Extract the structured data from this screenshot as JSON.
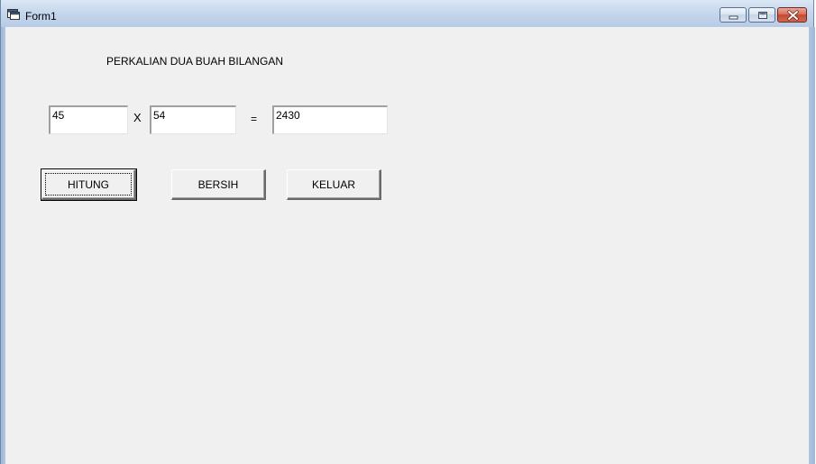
{
  "window": {
    "title": "Form1"
  },
  "form": {
    "heading": "PERKALIAN DUA BUAH BILANGAN",
    "operand1": "45",
    "operator": "X",
    "operand2": "54",
    "equals": "=",
    "result": "2430"
  },
  "buttons": {
    "hitung": "HITUNG",
    "bersih": "BERSIH",
    "keluar": "KELUAR"
  },
  "icons": {
    "app": "form-window-icon",
    "minimize": "minimize-icon",
    "maximize": "maximize-icon",
    "close": "close-icon"
  },
  "colors": {
    "client_background": "#f0f0f0",
    "close_button": "#c24a33"
  }
}
